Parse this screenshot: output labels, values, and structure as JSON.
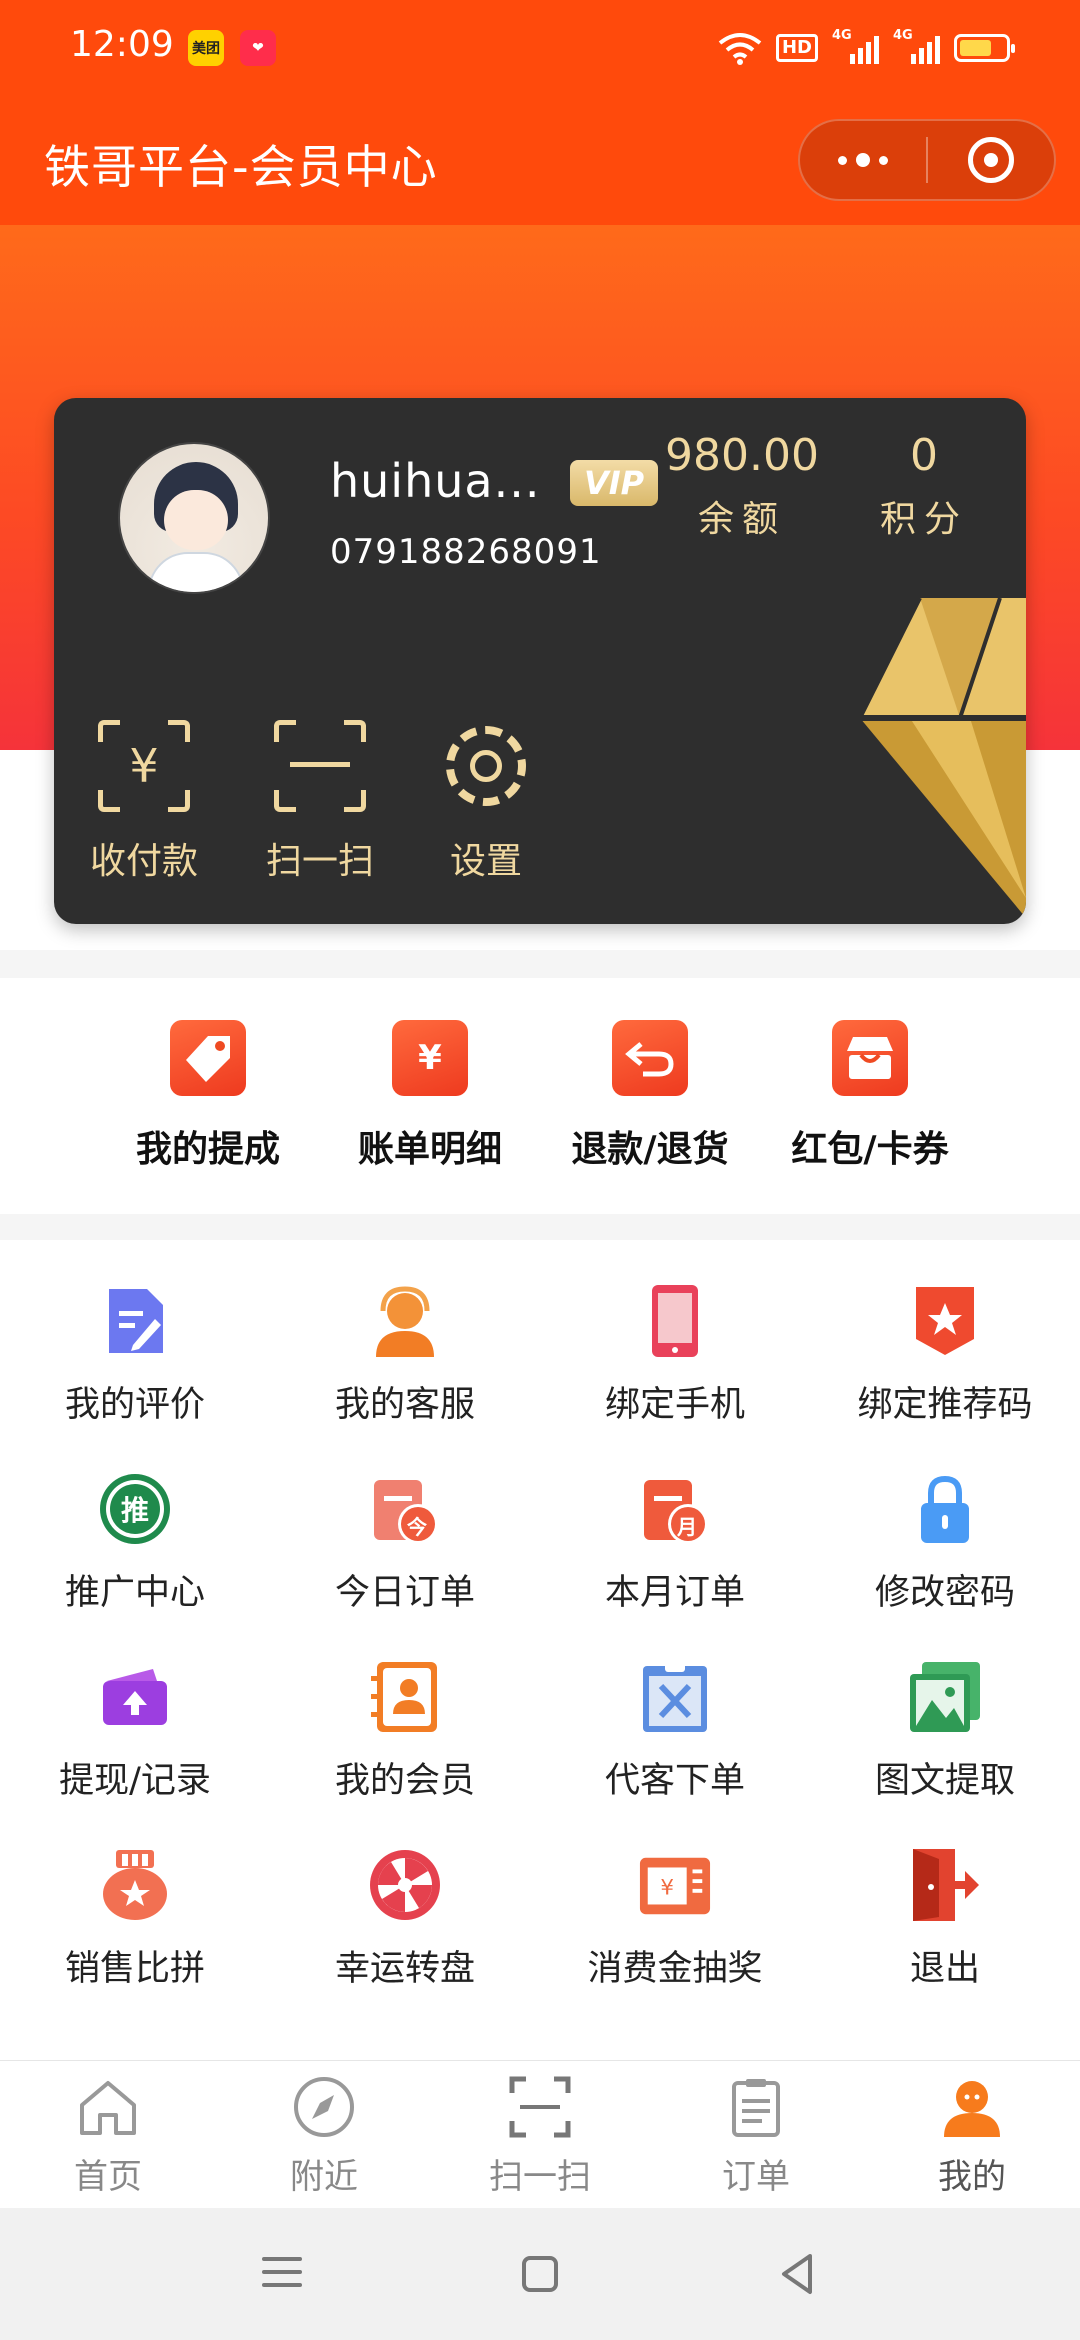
{
  "status_bar": {
    "time": "12:09",
    "apps": [
      {
        "name": "meituan-icon",
        "label": "美团"
      },
      {
        "name": "heart-app-icon",
        "label": ""
      }
    ],
    "network": {
      "hd": "HD",
      "sim1": "4G",
      "sim2": "4G"
    },
    "battery_level": 0.7
  },
  "header": {
    "title": "铁哥平台-会员中心"
  },
  "member": {
    "name": "huihua...",
    "vip_label": "VIP",
    "phone": "079188268091",
    "balance_value": "980.00",
    "balance_label": "余额",
    "points_value": "0",
    "points_label": "积分",
    "actions": [
      {
        "label": "收付款",
        "icon": "payment-qr-icon"
      },
      {
        "label": "扫一扫",
        "icon": "scan-icon"
      },
      {
        "label": "设置",
        "icon": "gear-icon"
      }
    ]
  },
  "shortcuts": [
    {
      "label": "我的提成",
      "icon": "tag-icon"
    },
    {
      "label": "账单明细",
      "icon": "bill-icon"
    },
    {
      "label": "退款/退货",
      "icon": "return-icon"
    },
    {
      "label": "红包/卡券",
      "icon": "gift-box-icon"
    }
  ],
  "menu": [
    {
      "label": "我的评价",
      "icon": "review-icon"
    },
    {
      "label": "我的客服",
      "icon": "customer-service-icon"
    },
    {
      "label": "绑定手机",
      "icon": "phone-icon"
    },
    {
      "label": "绑定推荐码",
      "icon": "star-badge-icon"
    },
    {
      "label": "推广中心",
      "icon": "promote-icon",
      "glyph": "推"
    },
    {
      "label": "今日订单",
      "icon": "today-order-icon",
      "glyph": "今"
    },
    {
      "label": "本月订单",
      "icon": "month-order-icon",
      "glyph": "月"
    },
    {
      "label": "修改密码",
      "icon": "lock-icon"
    },
    {
      "label": "提现/记录",
      "icon": "wallet-icon"
    },
    {
      "label": "我的会员",
      "icon": "member-card-icon"
    },
    {
      "label": "代客下单",
      "icon": "clipboard-tools-icon"
    },
    {
      "label": "图文提取",
      "icon": "image-icon"
    },
    {
      "label": "销售比拼",
      "icon": "medal-icon"
    },
    {
      "label": "幸运转盘",
      "icon": "wheel-icon"
    },
    {
      "label": "消费金抽奖",
      "icon": "lottery-ticket-icon"
    },
    {
      "label": "退出",
      "icon": "exit-icon"
    }
  ],
  "tabs": [
    {
      "label": "首页",
      "icon": "home-icon"
    },
    {
      "label": "附近",
      "icon": "compass-icon"
    },
    {
      "label": "扫一扫",
      "icon": "scan-icon"
    },
    {
      "label": "订单",
      "icon": "order-icon"
    },
    {
      "label": "我的",
      "icon": "user-icon",
      "active": true
    }
  ],
  "colors": {
    "brand": "#ff4a0c",
    "card": "#2e2e2e",
    "gold": "#f0d8a0",
    "active_tab": "#f77b1c"
  }
}
